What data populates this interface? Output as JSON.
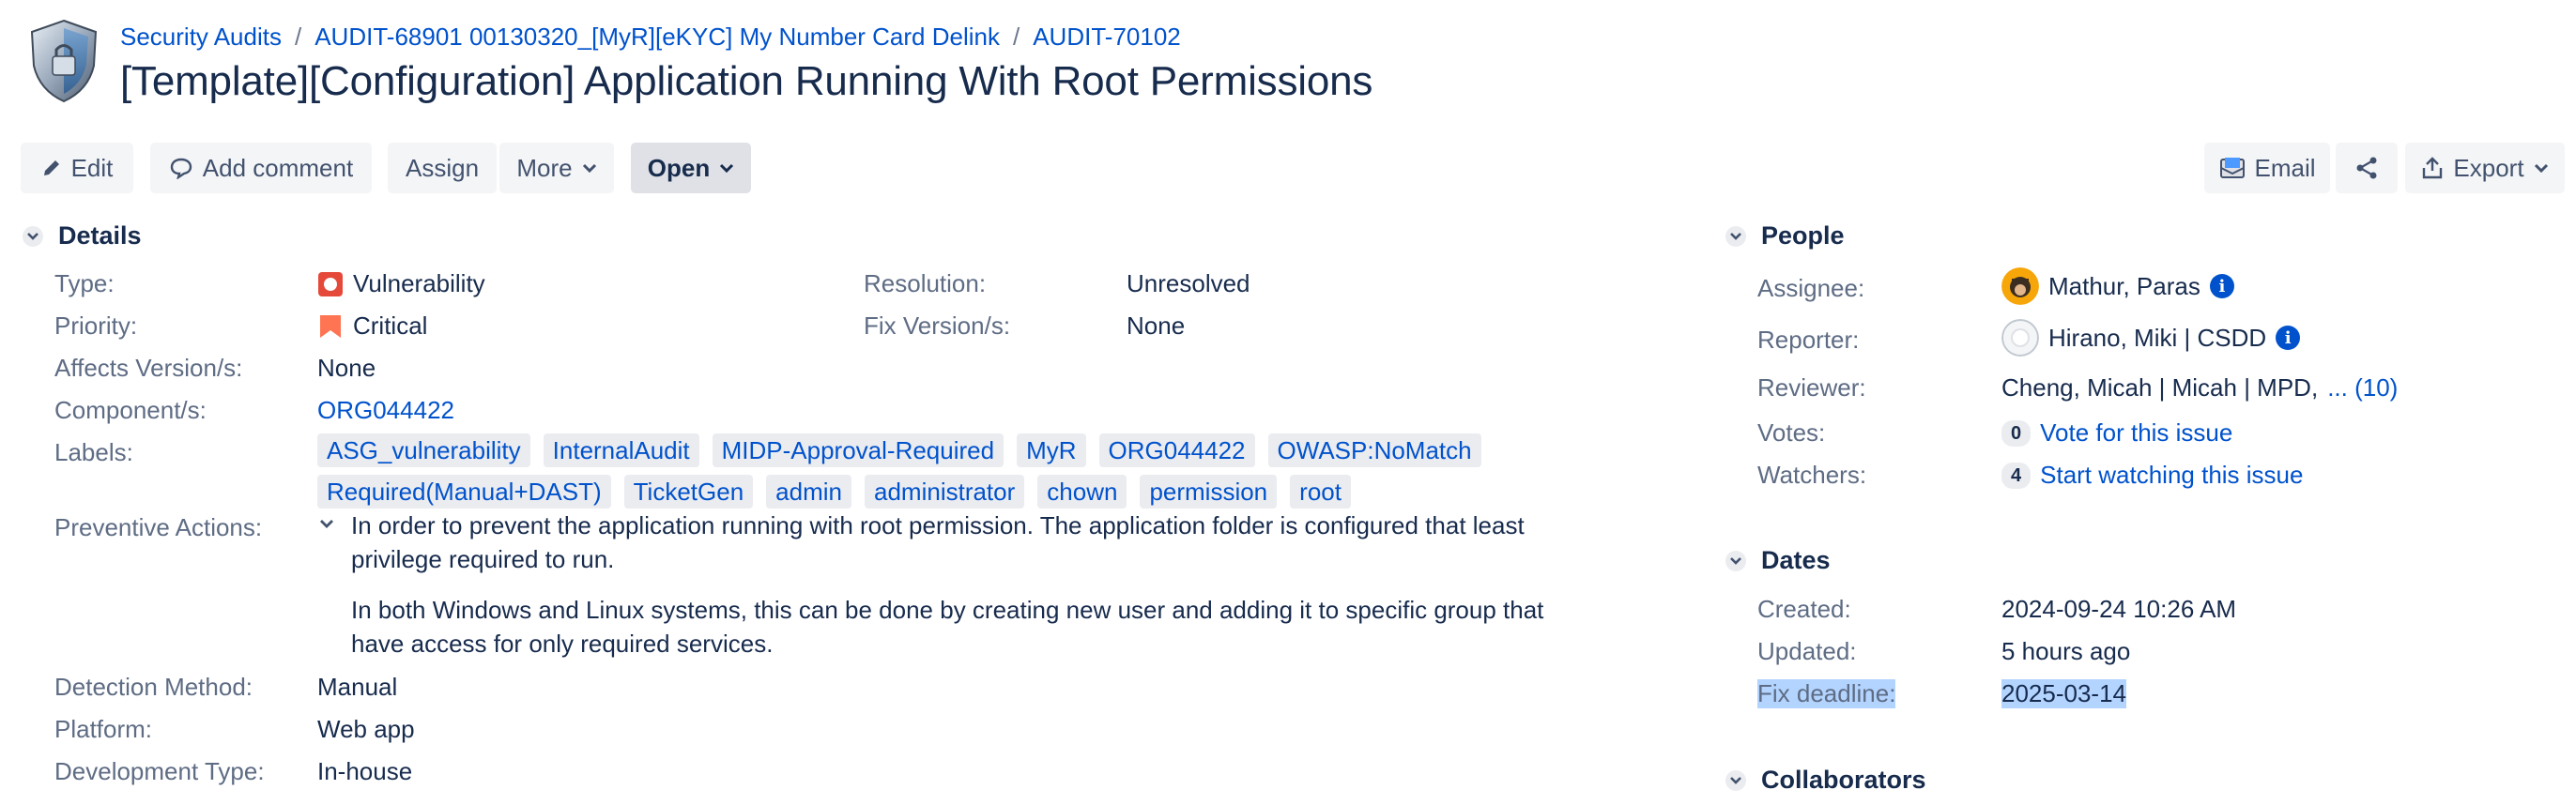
{
  "breadcrumbs": {
    "project": "Security Audits",
    "parent": "AUDIT-68901 00130320_[MyR][eKYC] My Number Card Delink",
    "issue_key": "AUDIT-70102"
  },
  "issue": {
    "title": "[Template][Configuration] Application Running With Root Permissions"
  },
  "toolbar": {
    "edit": "Edit",
    "add_comment": "Add comment",
    "assign": "Assign",
    "more": "More",
    "status": "Open",
    "email": "Email",
    "export": "Export"
  },
  "details": {
    "heading": "Details",
    "type_label": "Type:",
    "type_value": "Vulnerability",
    "priority_label": "Priority:",
    "priority_value": "Critical",
    "affects_label": "Affects Version/s:",
    "affects_value": "None",
    "component_label": "Component/s:",
    "component_value": "ORG044422",
    "labels_label": "Labels:",
    "labels": [
      "ASG_vulnerability",
      "InternalAudit",
      "MIDP-Approval-Required",
      "MyR",
      "ORG044422",
      "OWASP:NoMatch",
      "Required(Manual+DAST)",
      "TicketGen",
      "admin",
      "administrator",
      "chown",
      "permission",
      "root"
    ],
    "resolution_label": "Resolution:",
    "resolution_value": "Unresolved",
    "fix_version_label": "Fix Version/s:",
    "fix_version_value": "None",
    "preventive_label": "Preventive Actions:",
    "preventive_p1": "In order to prevent the application running with root permission. The application folder is configured that least privilege required to run.",
    "preventive_p2": "In both Windows and Linux systems, this can be done by creating new user and adding it to specific group that have access for only required services.",
    "detection_label": "Detection Method:",
    "detection_value": "Manual",
    "platform_label": "Platform:",
    "platform_value": "Web app",
    "devtype_label": "Development Type:",
    "devtype_value": "In-house"
  },
  "people": {
    "heading": "People",
    "assignee_label": "Assignee:",
    "assignee_value": "Mathur, Paras",
    "reporter_label": "Reporter:",
    "reporter_value": "Hirano, Miki | CSDD",
    "reviewer_label": "Reviewer:",
    "reviewer_value": "Cheng, Micah | Micah | MPD,",
    "reviewer_more": "... (10)",
    "votes_label": "Votes:",
    "votes_count": "0",
    "votes_link": "Vote for this issue",
    "watchers_label": "Watchers:",
    "watchers_count": "4",
    "watchers_link": "Start watching this issue"
  },
  "dates": {
    "heading": "Dates",
    "created_label": "Created:",
    "created_value": "2024-09-24 10:26 AM",
    "updated_label": "Updated:",
    "updated_value": "5 hours ago",
    "deadline_label": "Fix deadline:",
    "deadline_value": "2025-03-14"
  },
  "collaborators": {
    "heading": "Collaborators"
  },
  "colors": {
    "link": "#0052cc",
    "vulnerability": "#e5493a",
    "critical": "#ff7452",
    "selection": "#b3d4ff"
  }
}
